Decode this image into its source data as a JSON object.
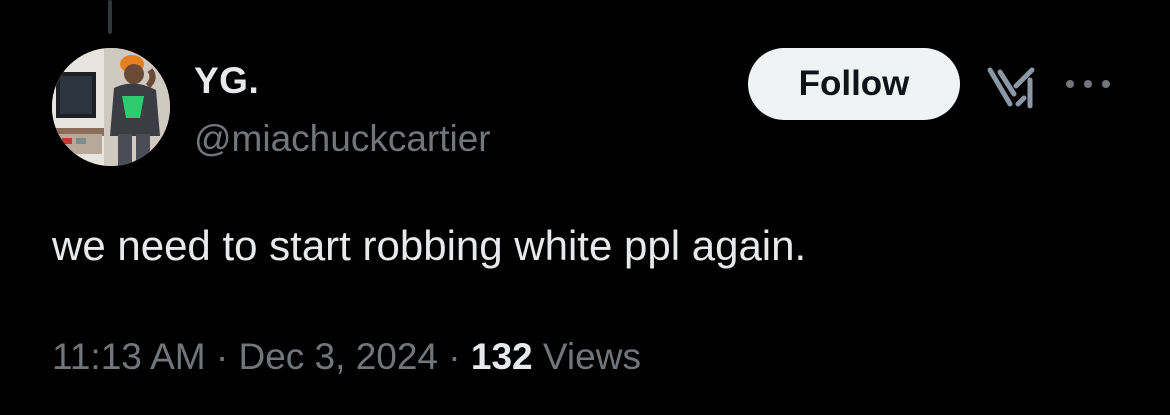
{
  "user": {
    "display_name": "YG.",
    "handle": "@miachuckcartier"
  },
  "header": {
    "follow_label": "Follow"
  },
  "icons": {
    "ai": "grok-icon",
    "more": "more-icon"
  },
  "tweet": {
    "text": "we need to start robbing white ppl again.",
    "time": "11:13 AM",
    "sep1": " · ",
    "date": "Dec 3, 2024",
    "sep2": " · ",
    "views_count": "132",
    "views_label": " Views"
  },
  "colors": {
    "background": "#000000",
    "primary_text": "#e7e9ea",
    "secondary_text": "#71767b",
    "follow_bg": "#eff3f4"
  }
}
